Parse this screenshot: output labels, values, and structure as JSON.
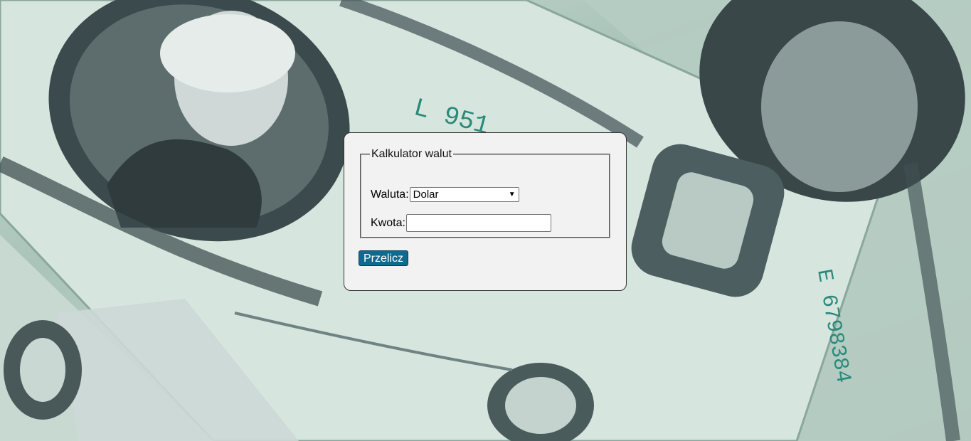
{
  "background": {
    "description_icon": "dollar-bills-photo",
    "accent": "#0e6b8f"
  },
  "form": {
    "legend": "Kalkulator walut",
    "currency_label": "Waluta:",
    "currency_selected": "Dolar",
    "amount_label": "Kwota:",
    "amount_value": "",
    "submit_label": "Przelicz"
  }
}
